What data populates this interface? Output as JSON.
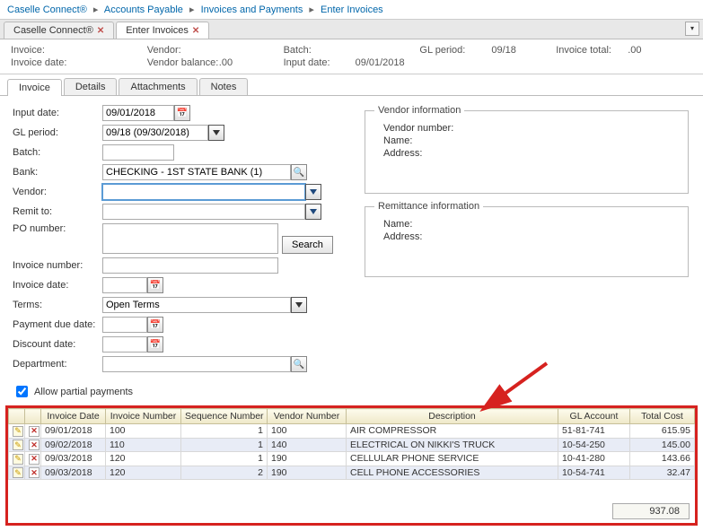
{
  "breadcrumb": [
    "Caselle Connect®",
    "Accounts Payable",
    "Invoices and Payments",
    "Enter Invoices"
  ],
  "topTabs": [
    {
      "label": "Caselle Connect®",
      "closable": true,
      "active": false
    },
    {
      "label": "Enter Invoices",
      "closable": true,
      "active": true
    }
  ],
  "summary": {
    "left": {
      "invoice_label": "Invoice:",
      "invoice_value": "",
      "invoice_date_label": "Invoice date:",
      "invoice_date_value": ""
    },
    "mid": {
      "vendor_label": "Vendor:",
      "vendor_value": "",
      "vendor_balance_label": "Vendor balance:",
      "vendor_balance_value": ".00"
    },
    "right1": {
      "batch_label": "Batch:",
      "batch_value": "",
      "input_date_label": "Input date:",
      "input_date_value": "09/01/2018"
    },
    "right2": {
      "gl_period_label": "GL period:",
      "gl_period_value": "09/18"
    },
    "right3": {
      "invoice_total_label": "Invoice total:",
      "invoice_total_value": ".00"
    }
  },
  "innerTabs": [
    "Invoice",
    "Details",
    "Attachments",
    "Notes"
  ],
  "form": {
    "input_date_label": "Input date:",
    "input_date_value": "09/01/2018",
    "gl_period_label": "GL period:",
    "gl_period_value": "09/18 (09/30/2018)",
    "batch_label": "Batch:",
    "batch_value": "",
    "bank_label": "Bank:",
    "bank_value": "CHECKING - 1ST STATE BANK (1)",
    "vendor_label": "Vendor:",
    "vendor_value": "",
    "remit_to_label": "Remit to:",
    "remit_to_value": "",
    "po_number_label": "PO number:",
    "po_number_value": "",
    "search_label": "Search",
    "invoice_number_label": "Invoice number:",
    "invoice_number_value": "",
    "invoice_date_label": "Invoice date:",
    "invoice_date_value": "",
    "terms_label": "Terms:",
    "terms_value": "Open Terms",
    "payment_due_label": "Payment due date:",
    "payment_due_value": "",
    "discount_date_label": "Discount date:",
    "discount_date_value": "",
    "department_label": "Department:",
    "department_value": "",
    "allow_partial_label": "Allow partial payments",
    "allow_partial_checked": true
  },
  "vendor_info": {
    "legend": "Vendor information",
    "vendor_number_label": "Vendor number:",
    "vendor_number_value": "",
    "name_label": "Name:",
    "name_value": "",
    "address_label": "Address:",
    "address_value": ""
  },
  "remit_info": {
    "legend": "Remittance information",
    "name_label": "Name:",
    "name_value": "",
    "address_label": "Address:",
    "address_value": ""
  },
  "grid": {
    "headers": [
      "",
      "",
      "Invoice Date",
      "Invoice Number",
      "Sequence Number",
      "Vendor Number",
      "Description",
      "GL Account",
      "Total Cost"
    ],
    "rows": [
      {
        "date": "09/01/2018",
        "inv": "100",
        "seq": "1",
        "vnd": "100",
        "desc": "AIR COMPRESSOR",
        "gl": "51-81-741",
        "cost": "615.95"
      },
      {
        "date": "09/02/2018",
        "inv": "110",
        "seq": "1",
        "vnd": "140",
        "desc": "ELECTRICAL ON NIKKI'S TRUCK",
        "gl": "10-54-250",
        "cost": "145.00"
      },
      {
        "date": "09/03/2018",
        "inv": "120",
        "seq": "1",
        "vnd": "190",
        "desc": "CELLULAR PHONE SERVICE",
        "gl": "10-41-280",
        "cost": "143.66"
      },
      {
        "date": "09/03/2018",
        "inv": "120",
        "seq": "2",
        "vnd": "190",
        "desc": "CELL PHONE ACCESSORIES",
        "gl": "10-54-741",
        "cost": "32.47"
      }
    ],
    "total": "937.08"
  }
}
